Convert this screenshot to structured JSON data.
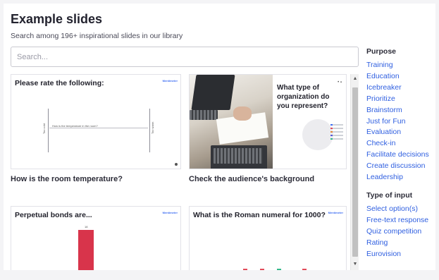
{
  "header": {
    "title": "Example slides",
    "subtitle": "Search among 196+ inspirational slides in our library"
  },
  "search": {
    "placeholder": "Search..."
  },
  "cards": [
    {
      "slide_heading": "Please rate the following:",
      "question": "How is the temperature in the room?",
      "left_axis": "Too cold",
      "right_axis": "Too warm",
      "logo": "Mentimeter",
      "caption": "How is the room temperature?"
    },
    {
      "slide_heading": "What type of organization do you represent?",
      "logo": "Mentimeter",
      "caption": "Check the audience's background"
    },
    {
      "slide_heading": "Perpetual bonds are...",
      "bar_value": "18",
      "logo": "Mentimeter",
      "caption": ""
    },
    {
      "slide_heading": "What is the Roman numeral for 1000?",
      "logo": "Mentimeter",
      "caption": ""
    }
  ],
  "sidebar": {
    "purpose_title": "Purpose",
    "purpose_items": [
      "Training",
      "Education",
      "Icebreaker",
      "Prioritize",
      "Brainstorm",
      "Just for Fun",
      "Evaluation",
      "Check-in",
      "Facilitate decisions",
      "Create discussion",
      "Leadership"
    ],
    "input_title": "Type of input",
    "input_items": [
      "Select option(s)",
      "Free-text response",
      "Quiz competition",
      "Rating",
      "Eurovision"
    ]
  },
  "colors": {
    "link": "#2f5fe0",
    "bar": "#d8344b"
  }
}
